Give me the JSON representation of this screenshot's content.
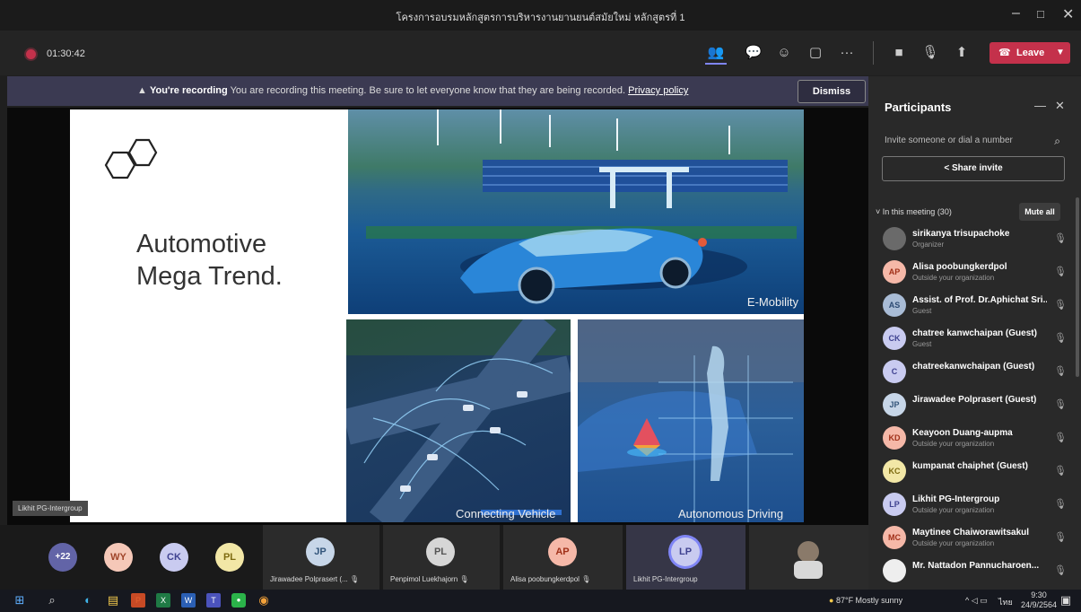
{
  "window": {
    "title": "โครงการอบรมหลักสูตรการบริหารงานยานยนต์สมัยใหม่ หลักสูตรที่ 1"
  },
  "toolbar": {
    "timer": "01:30:42",
    "leave_label": "Leave"
  },
  "banner": {
    "title": "You're recording",
    "message": "You are recording this meeting. Be sure to let everyone know that they are being recorded.",
    "link": "Privacy policy",
    "dismiss": "Dismiss"
  },
  "slide": {
    "title_line1": "Automotive",
    "title_line2": "Mega Trend.",
    "captions": [
      "E-Mobility",
      "Connecting Vehicle",
      "Autonomous Driving"
    ]
  },
  "presenter_tag": "Likhit PG-Intergroup",
  "strip": {
    "more_count": "+22",
    "small_avatars": [
      {
        "initials": "WY",
        "color": "#f5c8b8",
        "text_color": "#a0452a"
      },
      {
        "initials": "CK",
        "color": "#c9cbf0",
        "text_color": "#3f4290"
      },
      {
        "initials": "PL",
        "color": "#f2e7a6",
        "text_color": "#7d6a10"
      }
    ],
    "tiles": [
      {
        "initials": "JP",
        "name": "Jirawadee Polprasert (...",
        "color": "#c7d6e8",
        "text_color": "#33557a"
      },
      {
        "initials": "PL",
        "name": "Penpimol Luekhajorn",
        "color": "#d6d6d6",
        "text_color": "#555555"
      },
      {
        "initials": "AP",
        "name": "Alisa poobungkerdpol",
        "color": "#f5b8a8",
        "text_color": "#a03018"
      },
      {
        "initials": "LP",
        "name": "Likhit PG-Intergroup",
        "color": "#c9cbf0",
        "text_color": "#3f4290"
      }
    ]
  },
  "participants": {
    "title": "Participants",
    "invite_placeholder": "Invite someone or dial a number",
    "share_invite": "Share invite",
    "in_meeting": "In this meeting (30)",
    "mute_all": "Mute all",
    "list": [
      {
        "initials": "",
        "name": "sirikanya trisupachoke",
        "sub": "Organizer",
        "color": "#6a6a6a",
        "text_color": "#ffffff"
      },
      {
        "initials": "AP",
        "name": "Alisa poobungkerdpol",
        "sub": "Outside your organization",
        "color": "#f5b8a8",
        "text_color": "#a03018"
      },
      {
        "initials": "AS",
        "name": "Assist. of Prof. Dr.Aphichat Sri...",
        "sub": "Guest",
        "color": "#a9bcd6",
        "text_color": "#2c4a73"
      },
      {
        "initials": "CK",
        "name": "chatree kanwchaipan (Guest)",
        "sub": "Guest",
        "color": "#c9cbf0",
        "text_color": "#3f4290"
      },
      {
        "initials": "C",
        "name": "chatreekanwchaipan (Guest)",
        "sub": "",
        "color": "#c9cbf0",
        "text_color": "#3f4290"
      },
      {
        "initials": "JP",
        "name": "Jirawadee Polprasert (Guest)",
        "sub": "",
        "color": "#c7d6e8",
        "text_color": "#33557a"
      },
      {
        "initials": "KD",
        "name": "Keayoon Duang-aupma",
        "sub": "Outside your organization",
        "color": "#f5b8a8",
        "text_color": "#a03018"
      },
      {
        "initials": "KC",
        "name": "kumpanat chaiphet (Guest)",
        "sub": "",
        "color": "#f2e7a6",
        "text_color": "#7d6a10"
      },
      {
        "initials": "LP",
        "name": "Likhit PG-Intergroup",
        "sub": "Outside your organization",
        "color": "#c9cbf0",
        "text_color": "#3f4290"
      },
      {
        "initials": "MC",
        "name": "Maytinee Chaiworawitsakul",
        "sub": "Outside your organization",
        "color": "#f5b8a8",
        "text_color": "#a03018"
      },
      {
        "initials": "",
        "name": "Mr. Nattadon Pannucharoen...",
        "sub": "",
        "color": "#eeeeee",
        "text_color": "#333333"
      }
    ]
  },
  "taskbar": {
    "weather": "87°F  Mostly sunny",
    "time": "9:30",
    "date": "24/9/2564",
    "lang": "ไทย"
  }
}
